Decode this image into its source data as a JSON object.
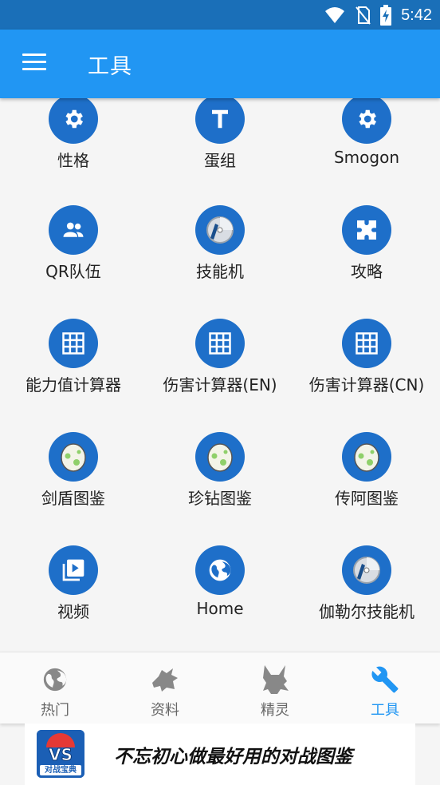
{
  "status_bar": {
    "time": "5:42",
    "icons": [
      "wifi-icon",
      "no-sim-icon",
      "battery-charging-icon"
    ]
  },
  "app_bar": {
    "title": "工具",
    "menu_icon": "hamburger-menu-icon"
  },
  "tools": [
    {
      "label": "性格",
      "icon": "gear-icon"
    },
    {
      "label": "蛋组",
      "icon": "text-t-icon"
    },
    {
      "label": "Smogon",
      "icon": "gear-icon"
    },
    {
      "label": "QR队伍",
      "icon": "people-icon"
    },
    {
      "label": "技能机",
      "icon": "disc-icon"
    },
    {
      "label": "攻略",
      "icon": "puzzle-icon"
    },
    {
      "label": "能力值计算器",
      "icon": "grid-icon"
    },
    {
      "label": "伤害计算器(EN)",
      "icon": "grid-icon"
    },
    {
      "label": "伤害计算器(CN)",
      "icon": "grid-icon"
    },
    {
      "label": "剑盾图鉴",
      "icon": "egg-icon"
    },
    {
      "label": "珍钻图鉴",
      "icon": "egg-icon"
    },
    {
      "label": "传阿图鉴",
      "icon": "egg-icon"
    },
    {
      "label": "视频",
      "icon": "video-library-icon"
    },
    {
      "label": "Home",
      "icon": "globe-icon"
    },
    {
      "label": "伽勒尔技能机",
      "icon": "disc-icon"
    }
  ],
  "bottom_nav": [
    {
      "label": "热门",
      "icon": "globe-icon",
      "active": false
    },
    {
      "label": "资料",
      "icon": "pokemon-silhouette-icon",
      "active": false
    },
    {
      "label": "精灵",
      "icon": "pikachu-silhouette-icon",
      "active": false
    },
    {
      "label": "工具",
      "icon": "wrench-icon",
      "active": true
    }
  ],
  "ad": {
    "logo_text": "对战宝典",
    "text": "不忘初心做最好用的对战图鉴"
  },
  "colors": {
    "status_bar": "#1a6fb8",
    "app_bar": "#2196f3",
    "icon_circle": "#1e6fc9",
    "active_tab": "#2196f3",
    "inactive_tab": "#888888"
  }
}
